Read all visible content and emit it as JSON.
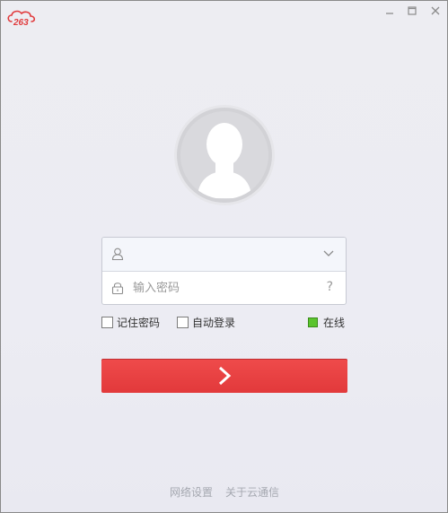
{
  "app": {
    "logo_text": "263"
  },
  "window_controls": [
    "minimize",
    "maximize",
    "close"
  ],
  "login": {
    "username_value": "",
    "password_placeholder": "输入密码",
    "help_label": "?",
    "remember_label": "记住密码",
    "autologin_label": "自动登录",
    "status_label": "在线",
    "status_color": "#5ac42d",
    "button_color": "#e8403f"
  },
  "footer": {
    "network_settings": "网络设置",
    "about": "关于云通信"
  }
}
